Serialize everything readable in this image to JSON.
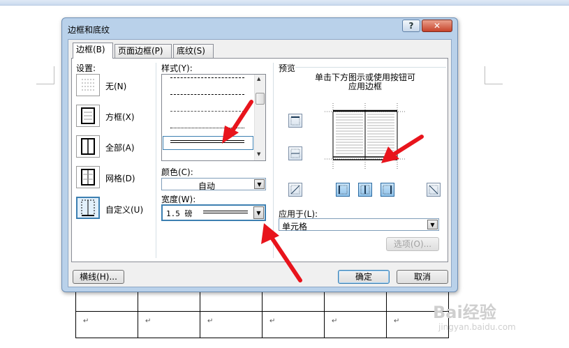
{
  "dialog": {
    "title": "边框和底纹",
    "help_label": "?",
    "close_label": "✕",
    "tabs": [
      {
        "label": "边框(B)",
        "active": true
      },
      {
        "label": "页面边框(P)",
        "active": false
      },
      {
        "label": "底纹(S)",
        "active": false
      }
    ]
  },
  "settings": {
    "header": "设置:",
    "items": [
      {
        "label": "无(N)"
      },
      {
        "label": "方框(X)"
      },
      {
        "label": "全部(A)"
      },
      {
        "label": "网格(D)"
      },
      {
        "label": "自定义(U)"
      }
    ]
  },
  "style": {
    "header": "样式(Y):",
    "color_label": "颜色(C):",
    "color_value": "自动",
    "width_label": "宽度(W):",
    "width_value": "1.5 磅"
  },
  "preview": {
    "header": "预览",
    "hint": "单击下方图示或使用按钮可\n应用边框",
    "apply_to_label": "应用于(L):",
    "apply_to_value": "单元格",
    "options_label": "选项(O)..."
  },
  "footer": {
    "horizontal_line_label": "横线(H)...",
    "ok_label": "确定",
    "cancel_label": "取消"
  },
  "document": {
    "paragraph_mark": "↵",
    "watermark": "Bai经验",
    "watermark_url": "jingyan.baidu.com"
  },
  "colors": {
    "annotation_arrow": "#e8141c",
    "dialog_frame": "#b9d1ea",
    "client": "#f0f0f0"
  }
}
